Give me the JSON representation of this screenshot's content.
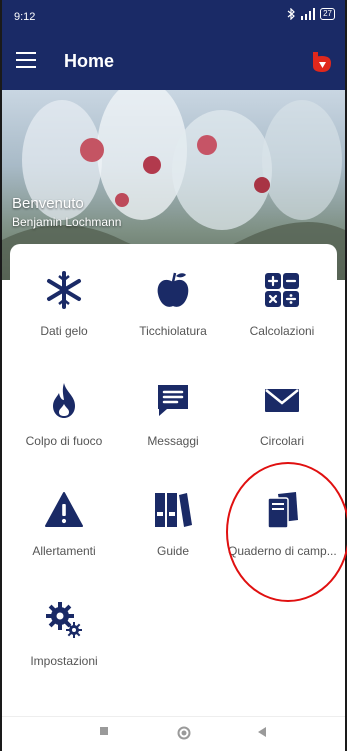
{
  "status_bar": {
    "time": "9:12",
    "battery": "27"
  },
  "app_bar": {
    "title": "Home",
    "menu_icon": "hamburger-icon",
    "logo": "brand-logo-icon"
  },
  "hero": {
    "welcome": "Benvenuto",
    "user_name": "Benjamin Lochmann"
  },
  "tiles": [
    {
      "label": "Dati gelo",
      "icon": "snowflake-icon"
    },
    {
      "label": "Ticchiolatura",
      "icon": "apple-icon"
    },
    {
      "label": "Calcolazioni",
      "icon": "calculator-icon"
    },
    {
      "label": "Colpo di fuoco",
      "icon": "fire-icon"
    },
    {
      "label": "Messaggi",
      "icon": "message-icon"
    },
    {
      "label": "Circolari",
      "icon": "envelope-icon"
    },
    {
      "label": "Allertamenti",
      "icon": "warning-icon"
    },
    {
      "label": "Guide",
      "icon": "binders-icon"
    },
    {
      "label": "Quaderno di camp...",
      "icon": "notebook-icon"
    },
    {
      "label": "Impostazioni",
      "icon": "gears-icon"
    }
  ],
  "nav_bar": {
    "recents": "recents-icon",
    "home": "home-icon",
    "back": "back-icon"
  },
  "colors": {
    "primary": "#1a2a66",
    "icon": "#1a2a66",
    "highlight": "#e01010",
    "brand": "#e0281c"
  }
}
